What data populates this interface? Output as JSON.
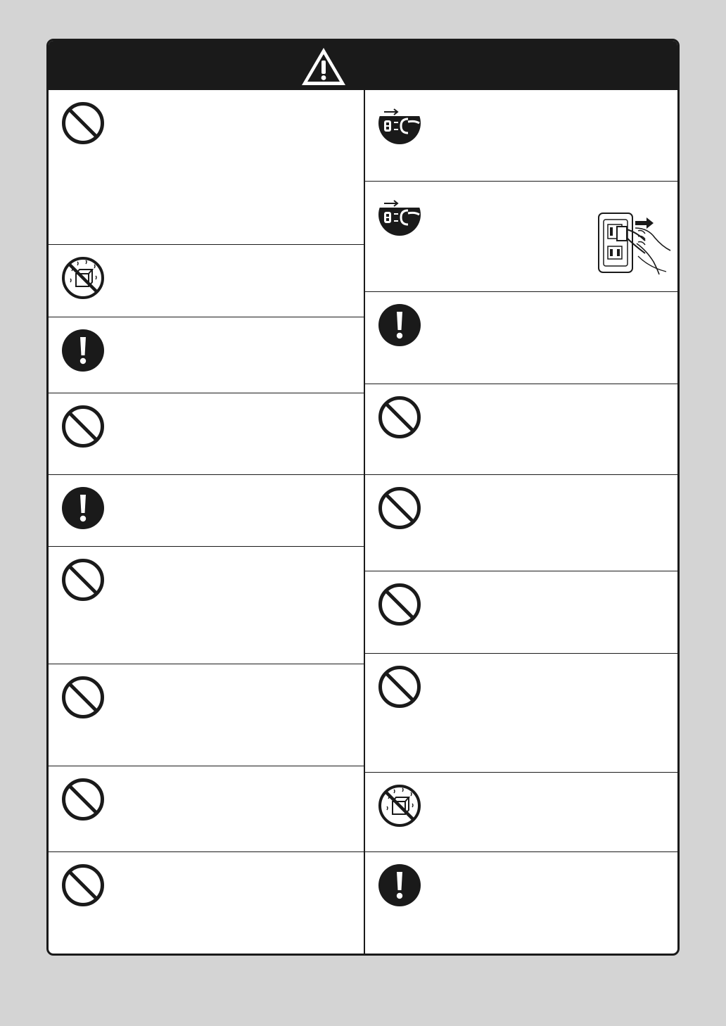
{
  "header": {
    "icon": "warning-triangle-icon",
    "color": "#1a1a1a"
  },
  "left_column": [
    {
      "icon": "prohibition-icon"
    },
    {
      "icon": "no-water-splash-icon"
    },
    {
      "icon": "mandatory-exclamation-icon"
    },
    {
      "icon": "prohibition-icon"
    },
    {
      "icon": "mandatory-exclamation-icon"
    },
    {
      "icon": "prohibition-icon"
    },
    {
      "icon": "prohibition-icon"
    },
    {
      "icon": "prohibition-icon"
    },
    {
      "icon": "prohibition-icon"
    }
  ],
  "right_column": [
    {
      "icon": "unplug-icon"
    },
    {
      "icon": "unplug-icon",
      "illustration": "wall-outlet-unplug-illustration"
    },
    {
      "icon": "mandatory-exclamation-icon"
    },
    {
      "icon": "prohibition-icon"
    },
    {
      "icon": "prohibition-icon"
    },
    {
      "icon": "prohibition-icon"
    },
    {
      "icon": "prohibition-icon"
    },
    {
      "icon": "no-water-splash-icon"
    },
    {
      "icon": "mandatory-exclamation-icon"
    }
  ]
}
